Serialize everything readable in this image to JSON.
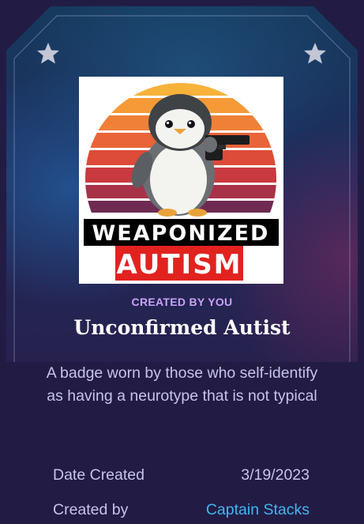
{
  "badge": {
    "origin_label": "CREATED BY YOU",
    "title": "Unconfirmed Autist",
    "description": "A badge worn by those who self-identify as having a neurotype that is not typical",
    "image_text": {
      "line1": "WEAPONIZED",
      "line2": "AUTISM"
    }
  },
  "details": {
    "date_label": "Date Created",
    "date_value": "3/19/2023",
    "creator_label": "Created by",
    "creator_value": "Captain Stacks"
  },
  "colors": {
    "accent_purple": "#c9a3f5",
    "link_blue": "#3fb8f0",
    "body_text": "#c7c3e8",
    "background": "#221c45"
  },
  "icons": [
    "star-icon",
    "star-icon"
  ]
}
